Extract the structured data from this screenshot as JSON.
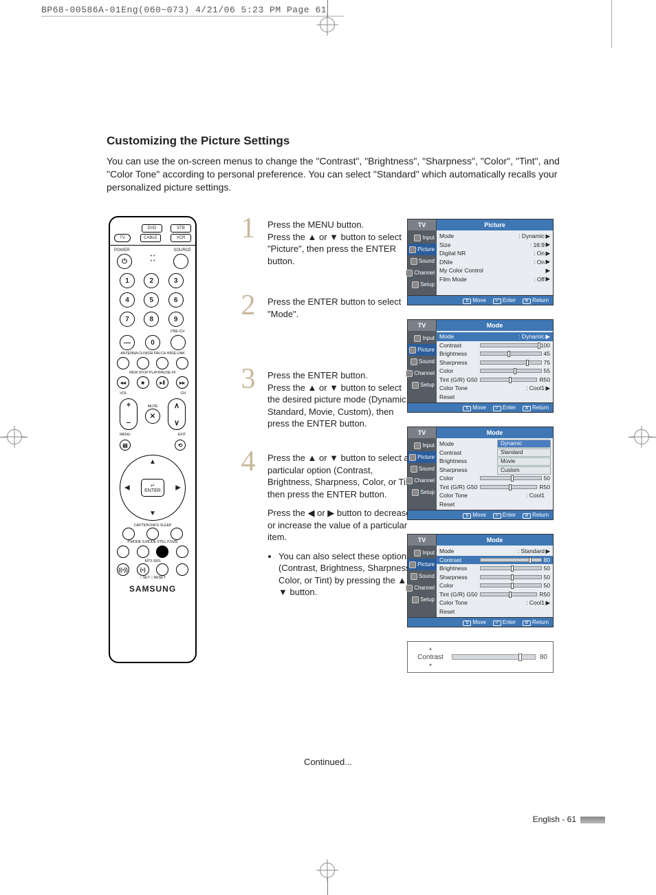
{
  "print_header": "BP68-00586A-01Eng(060~073)  4/21/06  5:23 PM  Page 61",
  "heading": "Customizing the Picture Settings",
  "intro": "You can use the on-screen menus to change the \"Contrast\", \"Brightness\", \"Sharpness\", \"Color\", \"Tint\", and \"Color Tone\" according to personal preference. You can select \"Standard\" which automatically recalls your personalized picture settings.",
  "remote": {
    "power": "POWER",
    "source": "SOURCE",
    "tv": "TV",
    "dvd": "DVD",
    "stb": "STB",
    "cable": "CABLE",
    "vcr": "VCR",
    "prech": "PRE-CH",
    "row_labels": "ANTENNA  CH MGR   FAV.CH   WISE LINK",
    "transport": "REW    STOP   PLAY/PAUSE   FF",
    "vol": "VOL",
    "ch": "CH",
    "mute": "MUTE",
    "menu": "MENU",
    "exit": "EXIT",
    "enter": "ENTER",
    "row_cis": "CAPTION        INFO          SLEEP",
    "row_pm": "P.MODE  S.MODE   STILL   P.SIZE",
    "row_ms": "MTS          SRS",
    "row_set": "○ SET      ○ RESET",
    "brand": "SAMSUNG"
  },
  "steps": [
    {
      "n": "1",
      "text": "Press the MENU button.\nPress the ▲ or ▼ button to select \"Picture\", then press the ENTER button."
    },
    {
      "n": "2",
      "text": "Press the ENTER button to select \"Mode\"."
    },
    {
      "n": "3",
      "text": "Press the ENTER button.\nPress the ▲ or ▼ button to select the desired picture mode (Dynamic, Standard, Movie, Custom), then press the ENTER button."
    },
    {
      "n": "4",
      "text": "Press the ▲ or ▼ button to select a particular option (Contrast, Brightness, Sharpness, Color, or Tint), then press the ENTER button.",
      "text2": "Press the ◀ or ▶ button to decrease or increase the value of a particular item.",
      "bullet": "You can also select these options (Contrast, Brightness, Sharpness, Color, or Tint) by pressing the ▲ or ▼ button."
    }
  ],
  "osd": {
    "tv": "TV",
    "side": [
      "Input",
      "Picture",
      "Sound",
      "Channel",
      "Setup"
    ],
    "foot_move": "Move",
    "foot_enter": "Enter",
    "foot_return": "Return",
    "p1": {
      "title": "Picture",
      "rows": [
        {
          "k": "Mode",
          "v": ": Dynamic",
          "a": "▶"
        },
        {
          "k": "Size",
          "v": ": 16:9",
          "a": "▶"
        },
        {
          "k": "Digital NR",
          "v": ": On",
          "a": "▶"
        },
        {
          "k": "DNIe",
          "v": ": On",
          "a": "▶"
        },
        {
          "k": "My Color Control",
          "v": "",
          "a": "▶"
        },
        {
          "k": "Film Mode",
          "v": ": Off",
          "a": "▶"
        }
      ]
    },
    "p2": {
      "title": "Mode",
      "rows": [
        {
          "k": "Mode",
          "v": ": Dynamic",
          "a": "▶",
          "hi": true
        },
        {
          "k": "Contrast",
          "bar": 100,
          "val": "100"
        },
        {
          "k": "Brightness",
          "bar": 45,
          "val": "45"
        },
        {
          "k": "Sharpness",
          "bar": 75,
          "val": "75"
        },
        {
          "k": "Color",
          "bar": 55,
          "val": "55"
        },
        {
          "k": "Tint (G/R)",
          "split": true,
          "lv": "G50",
          "rv": "R50"
        },
        {
          "k": "Color Tone",
          "v": ": Cool1",
          "a": "▶"
        },
        {
          "k": "Reset"
        }
      ]
    },
    "p3": {
      "title": "Mode",
      "modes": [
        "Dynamic",
        "Standard",
        "Movie",
        "Custom"
      ],
      "rows": [
        {
          "k": "Mode"
        },
        {
          "k": "Contrast"
        },
        {
          "k": "Brightness"
        },
        {
          "k": "Sharpness"
        },
        {
          "k": "Color",
          "bar": 50,
          "val": "50"
        },
        {
          "k": "Tint (G/R)",
          "split": true,
          "lv": "G50",
          "rv": "R50"
        },
        {
          "k": "Color Tone",
          "v": ": Cool1"
        },
        {
          "k": "Reset"
        }
      ]
    },
    "p4": {
      "title": "Mode",
      "rows": [
        {
          "k": "Mode",
          "v": ": Standard",
          "a": "▶"
        },
        {
          "k": "Contrast",
          "bar": 80,
          "val": "80",
          "hi": true
        },
        {
          "k": "Brightness",
          "bar": 50,
          "val": "50"
        },
        {
          "k": "Sharpness",
          "bar": 50,
          "val": "50"
        },
        {
          "k": "Color",
          "bar": 50,
          "val": "50"
        },
        {
          "k": "Tint (G/R)",
          "split": true,
          "lv": "G50",
          "rv": "R50"
        },
        {
          "k": "Color Tone",
          "v": ": Cool1",
          "a": "▶"
        },
        {
          "k": "Reset"
        }
      ]
    },
    "contrast": {
      "label": "Contrast",
      "value": "80",
      "pct": 80
    }
  },
  "continued": "Continued...",
  "footer": "English - 61"
}
